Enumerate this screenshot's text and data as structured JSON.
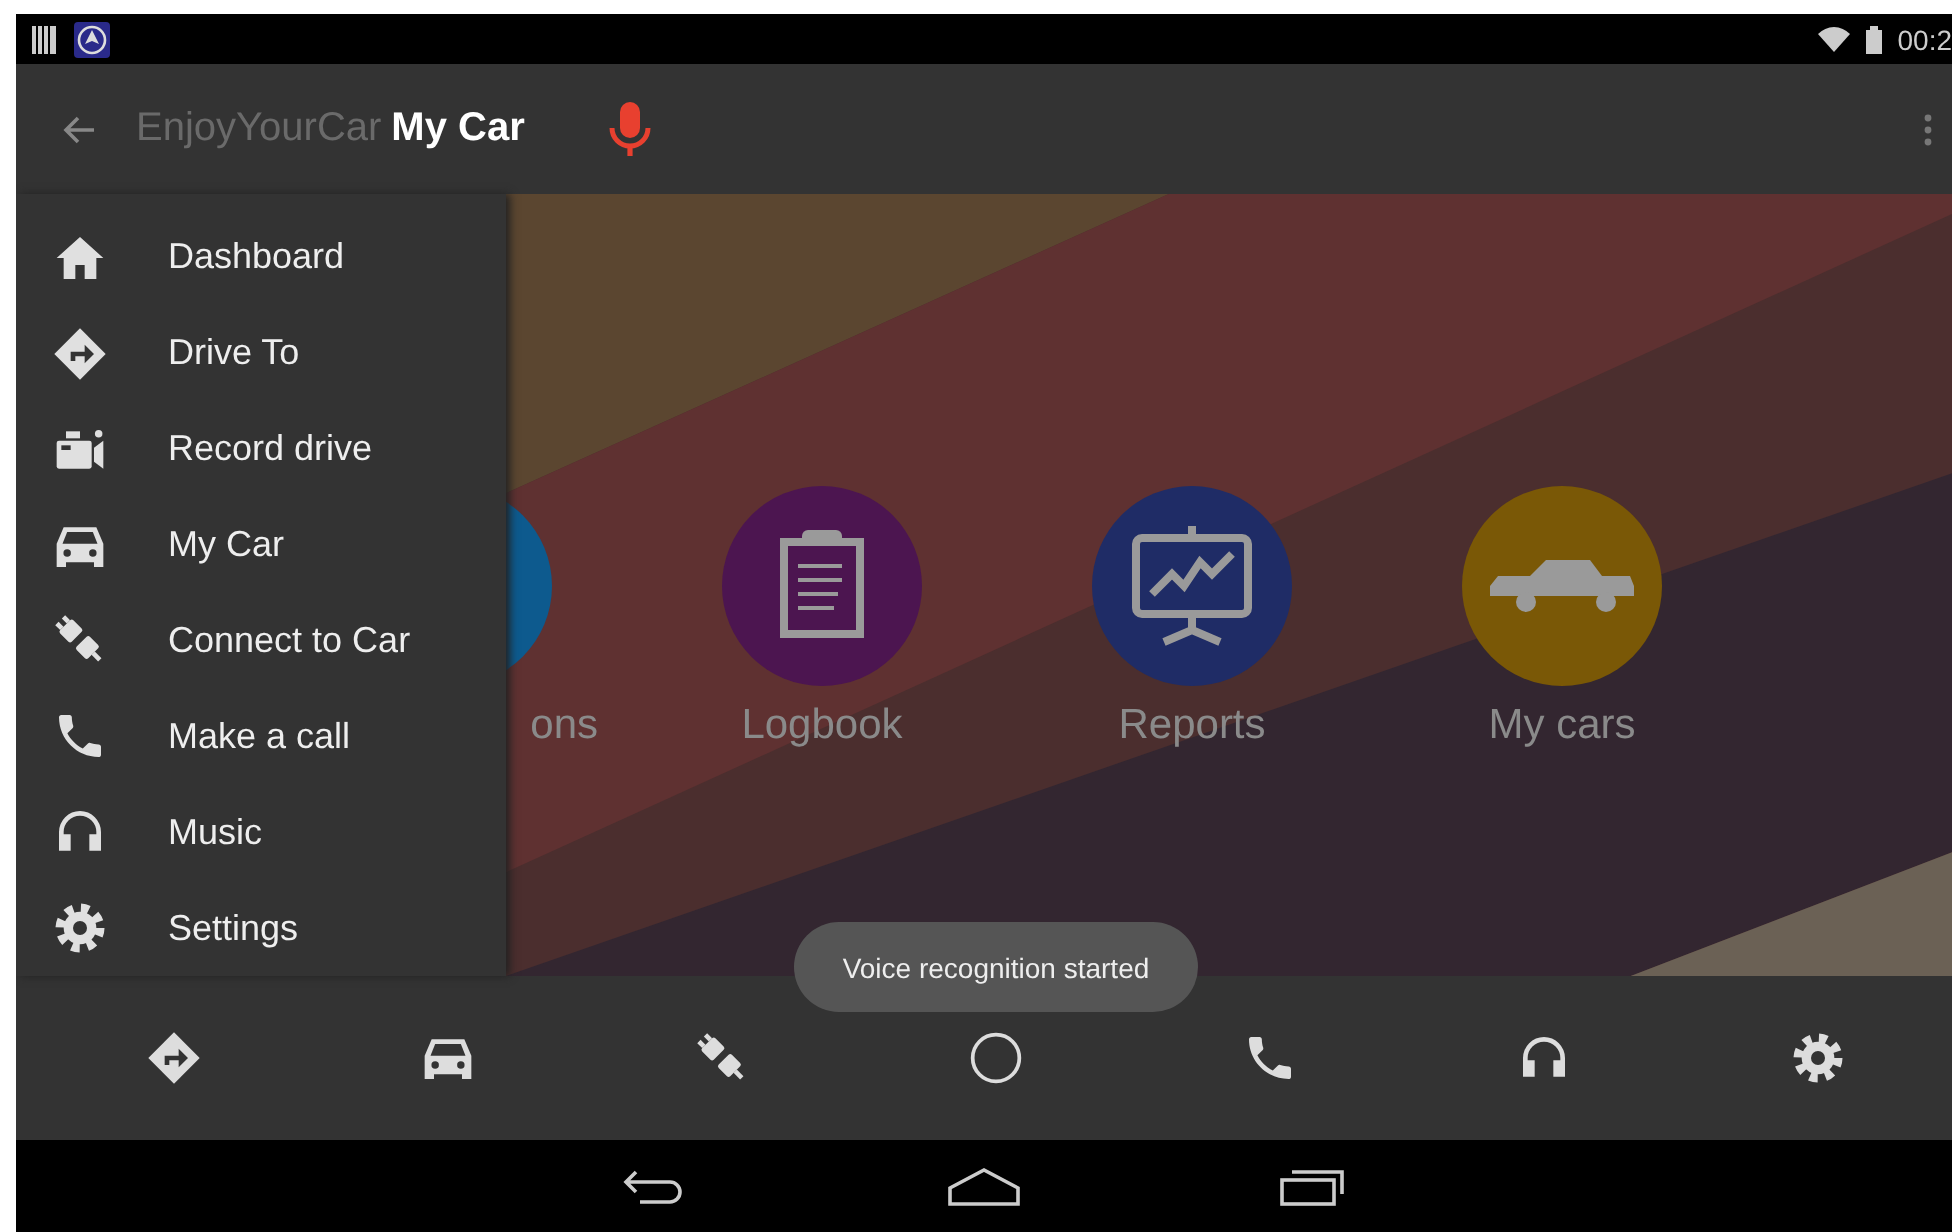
{
  "status_bar": {
    "time": "00:2"
  },
  "app_bar": {
    "app_name": "EnjoyYourCar",
    "screen_title": "My Car"
  },
  "drawer": {
    "items": [
      {
        "label": "Dashboard"
      },
      {
        "label": "Drive To"
      },
      {
        "label": "Record drive"
      },
      {
        "label": "My Car"
      },
      {
        "label": "Connect to Car"
      },
      {
        "label": "Make a call"
      },
      {
        "label": "Music"
      },
      {
        "label": "Settings"
      }
    ]
  },
  "tiles": [
    {
      "label": "ons",
      "color": "#0d5a8e"
    },
    {
      "label": "Logbook",
      "color": "#4c1550"
    },
    {
      "label": "Reports",
      "color": "#1f2c66"
    },
    {
      "label": "My cars",
      "color": "#7a5806"
    }
  ],
  "toast": "Voice recognition started"
}
